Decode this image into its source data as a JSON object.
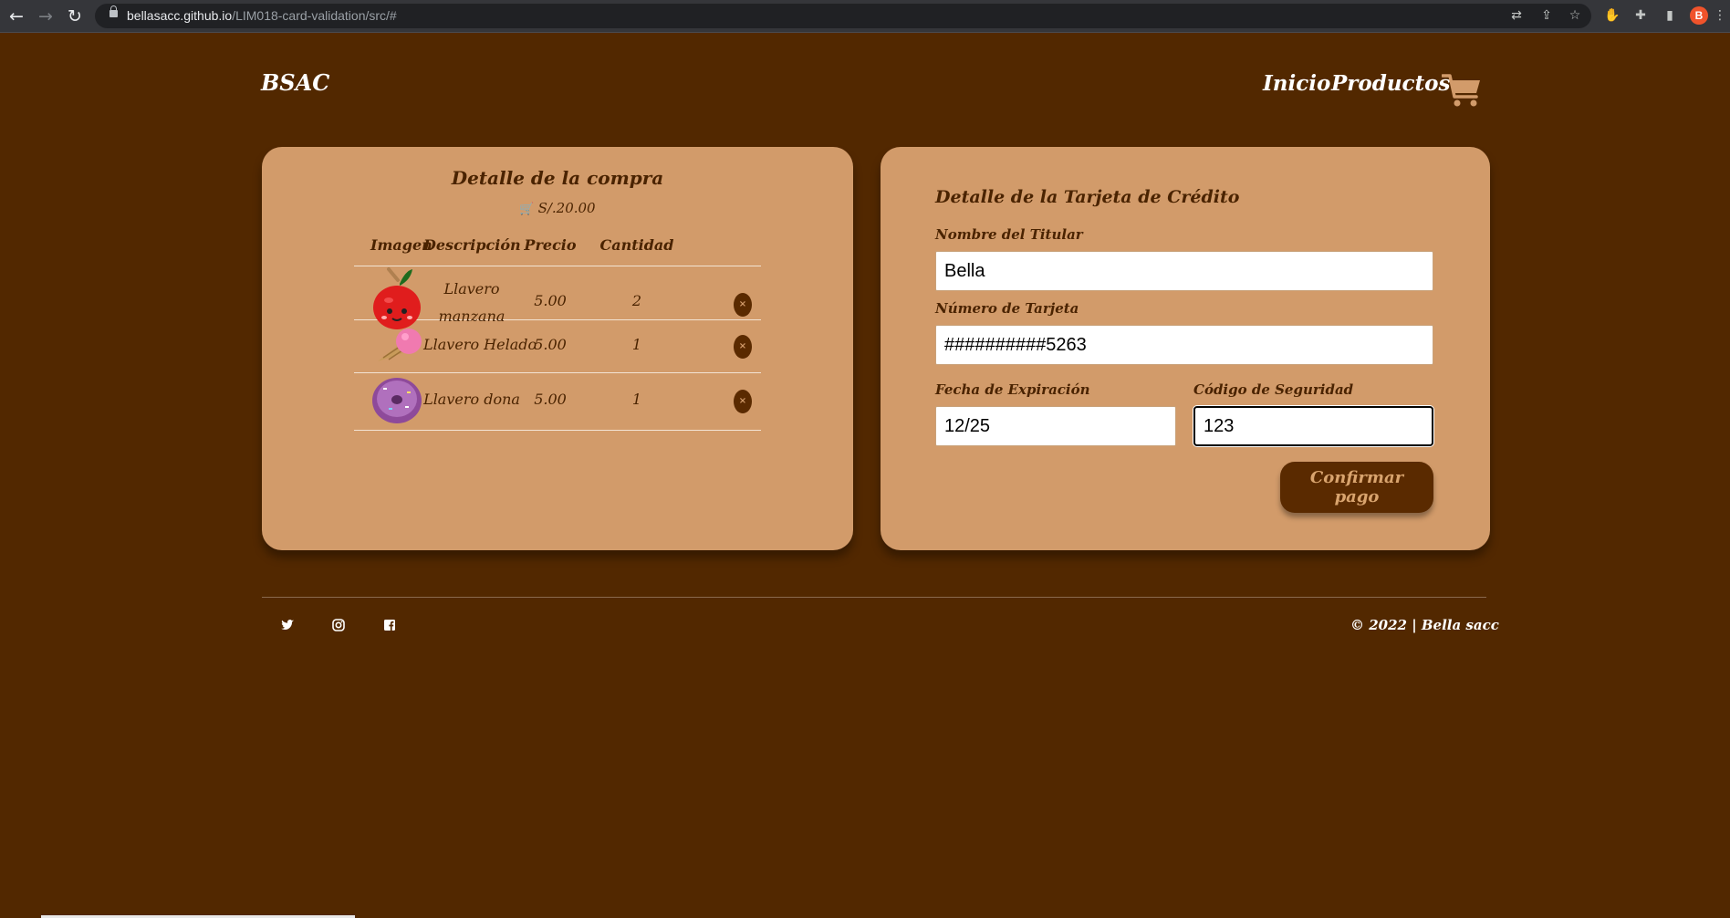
{
  "browser": {
    "url_host": "bellasacc.github.io",
    "url_path": "/LIM018-card-validation/src/#",
    "profile_initial": "B"
  },
  "header": {
    "logo": "BSAC",
    "nav": {
      "home": "Inicio",
      "products": "Productos"
    }
  },
  "order": {
    "title": "Detalle de la compra",
    "total": "S/.20.00",
    "columns": [
      "Imagen",
      "Descripción",
      "Precio",
      "Cantidad"
    ],
    "items": [
      {
        "description_line1": "Llavero",
        "description_line2": "manzana",
        "price": "5.00",
        "quantity": "2",
        "remove": "×"
      },
      {
        "description": "Llavero Helado",
        "price": "5.00",
        "quantity": "1",
        "remove": "×"
      },
      {
        "description": "Llavero dona",
        "price": "5.00",
        "quantity": "1",
        "remove": "×"
      }
    ]
  },
  "card_form": {
    "title": "Detalle de la Tarjeta de Crédito",
    "holder_label": "Nombre del Titular",
    "holder_value": "Bella",
    "number_label": "Número de Tarjeta",
    "number_value": "##########5263",
    "expiry_label": "Fecha de Expiración",
    "expiry_value": "12/25",
    "cvv_label": "Código de Seguridad",
    "cvv_value": "123",
    "submit_label": "Confirmar pago"
  },
  "footer": {
    "copyright": "© 2022 | Bella sacc"
  },
  "colors": {
    "background": "#522800",
    "card": "#d29b6a",
    "text_dark": "#4a2300",
    "button": "#5a2a00"
  }
}
